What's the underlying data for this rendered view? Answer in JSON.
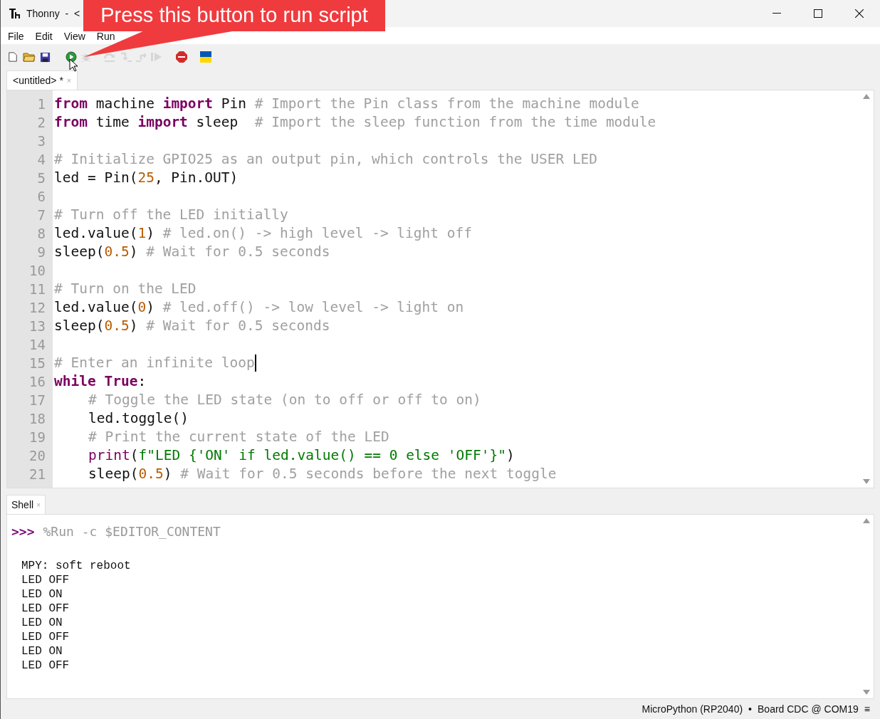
{
  "window": {
    "title": "Thonny  -  <"
  },
  "callout": {
    "text": "Press this button to run script"
  },
  "menu": [
    {
      "label": "File"
    },
    {
      "label": "Edit"
    },
    {
      "label": "View"
    },
    {
      "label": "Run"
    }
  ],
  "toolbar": [
    {
      "kind": "new",
      "disabled": false
    },
    {
      "kind": "open",
      "disabled": false
    },
    {
      "kind": "save",
      "disabled": false
    },
    {
      "kind": "run",
      "disabled": false
    },
    {
      "kind": "debug",
      "disabled": true
    },
    {
      "kind": "step-over",
      "disabled": true
    },
    {
      "kind": "step-into",
      "disabled": true
    },
    {
      "kind": "step-out",
      "disabled": true
    },
    {
      "kind": "resume",
      "disabled": true
    },
    {
      "kind": "stop",
      "disabled": false
    },
    {
      "kind": "flag",
      "disabled": false
    }
  ],
  "editor_tab": {
    "label": "<untitled> *",
    "close": "×"
  },
  "editor": {
    "lines": [
      {
        "number": "1",
        "indented": false,
        "caret": false,
        "tokens": [
          {
            "kind": "kw",
            "text": "from"
          },
          {
            "kind": "plain",
            "text": " machine "
          },
          {
            "kind": "kw",
            "text": "import"
          },
          {
            "kind": "plain",
            "text": " Pin "
          },
          {
            "kind": "comment",
            "text": "# Import the Pin class from the machine module"
          }
        ]
      },
      {
        "number": "2",
        "indented": false,
        "caret": false,
        "tokens": [
          {
            "kind": "kw",
            "text": "from"
          },
          {
            "kind": "plain",
            "text": " time "
          },
          {
            "kind": "kw",
            "text": "import"
          },
          {
            "kind": "plain",
            "text": " sleep  "
          },
          {
            "kind": "comment",
            "text": "# Import the sleep function from the time module"
          }
        ]
      },
      {
        "number": "3",
        "caret": false
      },
      {
        "number": "4",
        "indented": false,
        "caret": false,
        "tokens": [
          {
            "kind": "comment",
            "text": "# Initialize GPIO25 as an output pin, which controls the USER LED"
          }
        ]
      },
      {
        "number": "5",
        "indented": false,
        "caret": false,
        "tokens": [
          {
            "kind": "plain",
            "text": "led = Pin("
          },
          {
            "kind": "num",
            "text": "25"
          },
          {
            "kind": "plain",
            "text": ", Pin.OUT)"
          }
        ]
      },
      {
        "number": "6",
        "caret": false
      },
      {
        "number": "7",
        "indented": false,
        "caret": false,
        "tokens": [
          {
            "kind": "comment",
            "text": "# Turn off the LED initially"
          }
        ]
      },
      {
        "number": "8",
        "indented": false,
        "caret": false,
        "tokens": [
          {
            "kind": "plain",
            "text": "led.value("
          },
          {
            "kind": "num",
            "text": "1"
          },
          {
            "kind": "plain",
            "text": ") "
          },
          {
            "kind": "comment",
            "text": "# led.on() -> high level -> light off"
          }
        ]
      },
      {
        "number": "9",
        "indented": false,
        "caret": false,
        "tokens": [
          {
            "kind": "plain",
            "text": "sleep("
          },
          {
            "kind": "num",
            "text": "0.5"
          },
          {
            "kind": "plain",
            "text": ") "
          },
          {
            "kind": "comment",
            "text": "# Wait for 0.5 seconds"
          }
        ]
      },
      {
        "number": "10",
        "caret": false
      },
      {
        "number": "11",
        "indented": false,
        "caret": false,
        "tokens": [
          {
            "kind": "comment",
            "text": "# Turn on the LED"
          }
        ]
      },
      {
        "number": "12",
        "indented": false,
        "caret": false,
        "tokens": [
          {
            "kind": "plain",
            "text": "led.value("
          },
          {
            "kind": "num",
            "text": "0"
          },
          {
            "kind": "plain",
            "text": ") "
          },
          {
            "kind": "comment",
            "text": "# led.off() -> low level -> light on"
          }
        ]
      },
      {
        "number": "13",
        "indented": false,
        "caret": false,
        "tokens": [
          {
            "kind": "plain",
            "text": "sleep("
          },
          {
            "kind": "num",
            "text": "0.5"
          },
          {
            "kind": "plain",
            "text": ") "
          },
          {
            "kind": "comment",
            "text": "# Wait for 0.5 seconds"
          }
        ]
      },
      {
        "number": "14",
        "caret": false
      },
      {
        "number": "15",
        "indented": false,
        "caret": true,
        "tokens": [
          {
            "kind": "comment",
            "text": "# Enter an infinite loop"
          }
        ]
      },
      {
        "number": "16",
        "indented": false,
        "caret": false,
        "tokens": [
          {
            "kind": "kw",
            "text": "while True"
          },
          {
            "kind": "plain",
            "text": ":"
          }
        ]
      },
      {
        "number": "17",
        "indented": true,
        "caret": false,
        "tokens": [
          {
            "kind": "comment",
            "text": "# Toggle the LED state (on to off or off to on)"
          }
        ]
      },
      {
        "number": "18",
        "indented": true,
        "caret": false,
        "tokens": [
          {
            "kind": "plain",
            "text": "led.toggle()"
          }
        ]
      },
      {
        "number": "19",
        "indented": true,
        "caret": false,
        "tokens": [
          {
            "kind": "comment",
            "text": "# Print the current state of the LED"
          }
        ]
      },
      {
        "number": "20",
        "indented": true,
        "caret": false,
        "tokens": [
          {
            "kind": "builtin",
            "text": "print"
          },
          {
            "kind": "plain",
            "text": "("
          },
          {
            "kind": "str",
            "text": "f\"LED {'ON' if led.value() == 0 else 'OFF'}\""
          },
          {
            "kind": "plain",
            "text": ")"
          }
        ]
      },
      {
        "number": "21",
        "indented": true,
        "caret": false,
        "tokens": [
          {
            "kind": "plain",
            "text": "sleep("
          },
          {
            "kind": "num",
            "text": "0.5"
          },
          {
            "kind": "plain",
            "text": ") "
          },
          {
            "kind": "comment",
            "text": "# Wait for 0.5 seconds before the next toggle"
          }
        ]
      }
    ]
  },
  "shell_tab": {
    "label": "Shell",
    "close": "×"
  },
  "shell": {
    "prompt": ">>>",
    "command": "%Run -c $EDITOR_CONTENT",
    "output": [
      "MPY: soft reboot",
      "LED OFF",
      "LED ON",
      "LED OFF",
      "LED ON",
      "LED OFF",
      "LED ON",
      "LED OFF"
    ]
  },
  "status_bar": {
    "interpreter": "MicroPython (RP2040)",
    "separator": "•",
    "port": "Board CDC @ COM19",
    "menu": "≡"
  }
}
